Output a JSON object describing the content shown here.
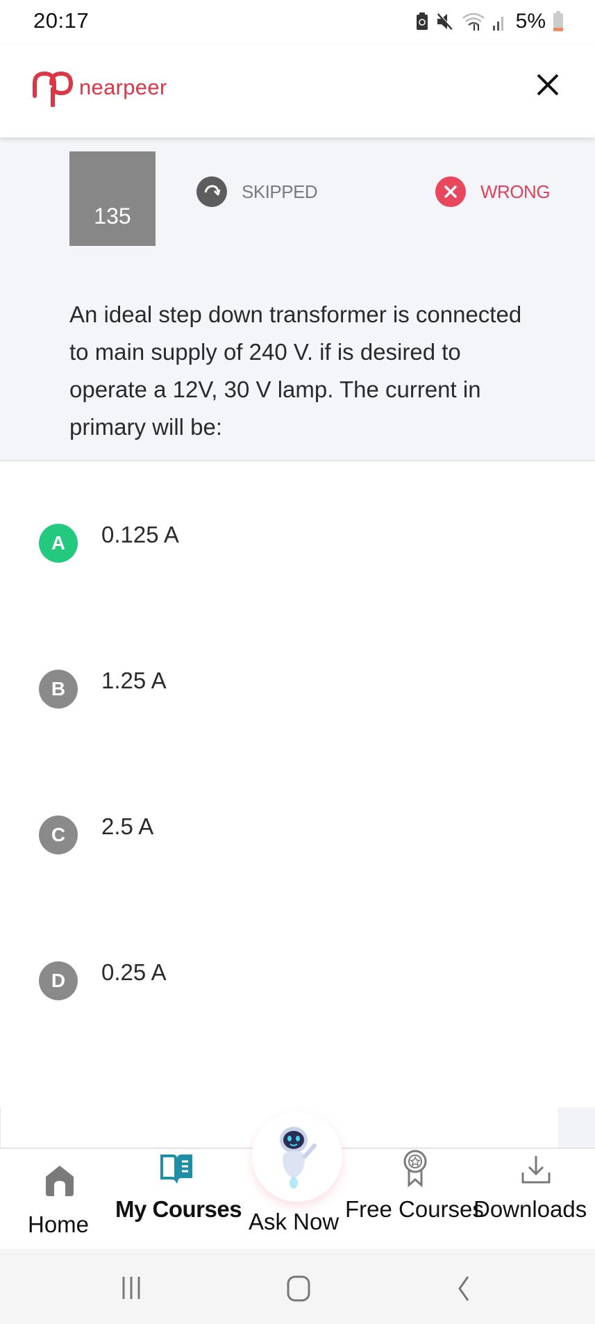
{
  "status_bar": {
    "time": "20:17",
    "battery_percent": "5%",
    "icons": [
      "battery-saver-icon",
      "mute-icon",
      "wifi-icon",
      "signal-icon",
      "battery-icon"
    ]
  },
  "header": {
    "brand": "nearpeer",
    "logo_icon": "nearpeer-logo-icon",
    "close_icon": "close-icon",
    "brand_color": "#dc3545"
  },
  "question": {
    "number": "135",
    "status_skipped": "SKIPPED",
    "status_wrong": "WRONG",
    "text": "An ideal step down transformer is connected to main supply of 240 V. if is desired to operate a 12V, 30 V lamp. The current in primary will be:"
  },
  "options": [
    {
      "letter": "A",
      "text": "0.125 A",
      "state": "correct",
      "color": "#23c97f"
    },
    {
      "letter": "B",
      "text": "1.25 A",
      "state": "neutral",
      "color": "#8a8a8a"
    },
    {
      "letter": "C",
      "text": "2.5 A",
      "state": "neutral",
      "color": "#8a8a8a"
    },
    {
      "letter": "D",
      "text": "0.25 A",
      "state": "neutral",
      "color": "#8a8a8a"
    }
  ],
  "bottom_nav": {
    "items": [
      {
        "label": "Home",
        "icon": "home-icon"
      },
      {
        "label": "My Courses",
        "icon": "book-icon",
        "active": true
      },
      {
        "label": "Ask Now",
        "icon": "robot-icon"
      },
      {
        "label": "Free Courses",
        "icon": "award-icon"
      },
      {
        "label": "Downloads",
        "icon": "download-icon"
      }
    ],
    "active_color": "#1f8fa8"
  },
  "system_nav": {
    "recents": "recents-icon",
    "home": "home-circle-icon",
    "back": "back-icon"
  }
}
